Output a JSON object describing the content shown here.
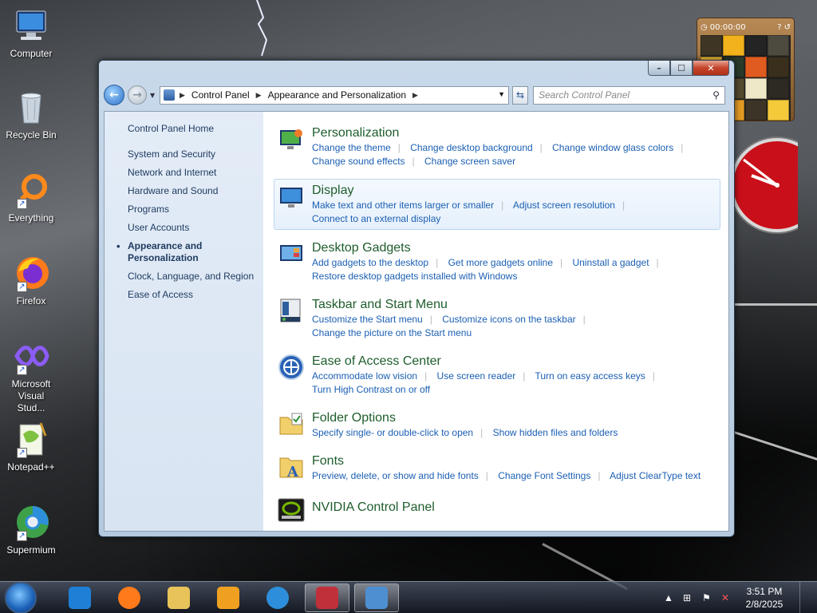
{
  "desktop": {
    "icons": [
      {
        "label": "Computer"
      },
      {
        "label": "Recycle Bin"
      },
      {
        "label": "Everything"
      },
      {
        "label": "Firefox"
      },
      {
        "label": "Microsoft Visual Stud..."
      },
      {
        "label": "Notepad++"
      },
      {
        "label": "Supermium"
      }
    ]
  },
  "gadgets": {
    "puzzle_timer": "00:00:00"
  },
  "window": {
    "caption": {
      "minimize": "–",
      "maximize": "☐",
      "close": "✕"
    },
    "address": {
      "crumbs": [
        "Control Panel",
        "Appearance and Personalization"
      ]
    },
    "search": {
      "placeholder": "Search Control Panel"
    },
    "sidebar": {
      "home": "Control Panel Home",
      "items": [
        {
          "label": "System and Security"
        },
        {
          "label": "Network and Internet"
        },
        {
          "label": "Hardware and Sound"
        },
        {
          "label": "Programs"
        },
        {
          "label": "User Accounts"
        },
        {
          "label": "Appearance and Personalization",
          "active": true
        },
        {
          "label": "Clock, Language, and Region"
        },
        {
          "label": "Ease of Access"
        }
      ]
    },
    "categories": [
      {
        "title": "Personalization",
        "links": [
          "Change the theme",
          "Change desktop background",
          "Change window glass colors",
          "Change sound effects",
          "Change screen saver"
        ]
      },
      {
        "title": "Display",
        "links": [
          "Make text and other items larger or smaller",
          "Adjust screen resolution",
          "Connect to an external display"
        ]
      },
      {
        "title": "Desktop Gadgets",
        "links": [
          "Add gadgets to the desktop",
          "Get more gadgets online",
          "Uninstall a gadget",
          "Restore desktop gadgets installed with Windows"
        ]
      },
      {
        "title": "Taskbar and Start Menu",
        "links": [
          "Customize the Start menu",
          "Customize icons on the taskbar",
          "Change the picture on the Start menu"
        ]
      },
      {
        "title": "Ease of Access Center",
        "links": [
          "Accommodate low vision",
          "Use screen reader",
          "Turn on easy access keys",
          "Turn High Contrast on or off"
        ]
      },
      {
        "title": "Folder Options",
        "links": [
          "Specify single- or double-click to open",
          "Show hidden files and folders"
        ]
      },
      {
        "title": "Fonts",
        "links": [
          "Preview, delete, or show and hide fonts",
          "Change Font Settings",
          "Adjust ClearType text"
        ]
      },
      {
        "title": "NVIDIA Control Panel",
        "links": []
      }
    ]
  },
  "taskbar": {
    "apps": [
      {
        "name": "internet-explorer-icon",
        "color": "#1f7fd6"
      },
      {
        "name": "firefox-icon",
        "color": "#ff7a1a"
      },
      {
        "name": "file-explorer-icon",
        "color": "#e8c35a"
      },
      {
        "name": "media-player-icon",
        "color": "#f0a020"
      },
      {
        "name": "supermium-icon",
        "color": "#2d8fdb"
      },
      {
        "name": "app-n-icon",
        "color": "#c0303a"
      },
      {
        "name": "control-panel-icon",
        "color": "#4d8fd1"
      }
    ],
    "clock": {
      "time": "3:51 PM",
      "date": "2/8/2025"
    }
  }
}
